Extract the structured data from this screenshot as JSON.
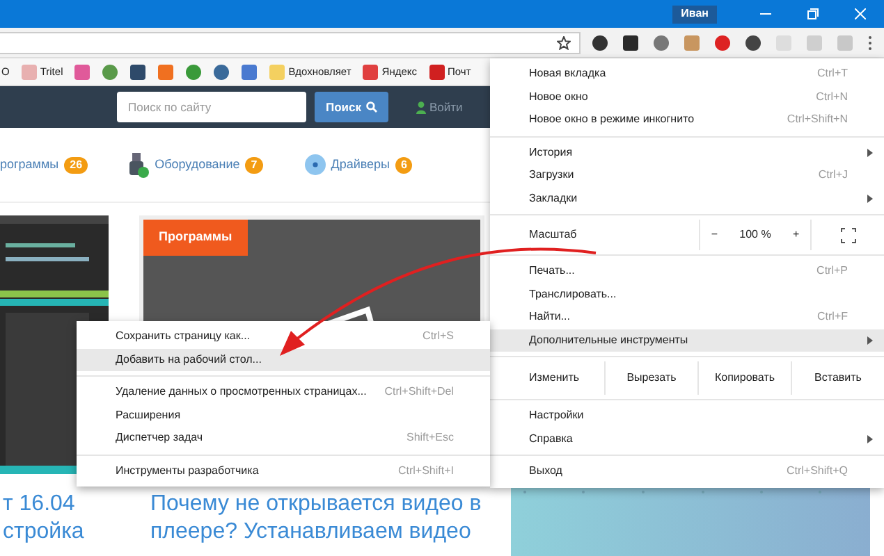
{
  "window": {
    "user": "Иван"
  },
  "bookmarks": [
    {
      "label": "О"
    },
    {
      "label": "Tritel"
    },
    {
      "label": "Вдохновляет"
    },
    {
      "label": "Яндекс"
    },
    {
      "label": "Почт"
    }
  ],
  "site": {
    "search": {
      "placeholder": "Поиск по сайту"
    },
    "search_button": "Поиск",
    "login": "Войти",
    "nav": [
      {
        "label": "рограммы",
        "count": "26"
      },
      {
        "label": "Оборудование",
        "count": "7"
      },
      {
        "label": "Драйверы",
        "count": "6"
      }
    ],
    "card_tag": "Программы",
    "articles": [
      {
        "lines": [
          "т 16.04",
          "стройка"
        ]
      },
      {
        "lines": [
          "Почему не открывается видео в",
          "плеере? Устанавливаем видео"
        ]
      }
    ]
  },
  "menu": [
    {
      "kind": "item",
      "label": "Новая вкладка",
      "shortcut": "Ctrl+T"
    },
    {
      "kind": "item",
      "label": "Новое окно",
      "shortcut": "Ctrl+N"
    },
    {
      "kind": "item",
      "label": "Новое окно в режиме инкогнито",
      "shortcut": "Ctrl+Shift+N"
    },
    {
      "kind": "divider"
    },
    {
      "kind": "item",
      "label": "История",
      "submenu": true
    },
    {
      "kind": "item",
      "label": "Загрузки",
      "shortcut": "Ctrl+J"
    },
    {
      "kind": "item",
      "label": "Закладки",
      "submenu": true
    },
    {
      "kind": "divider"
    },
    {
      "kind": "zoom",
      "label": "Масштаб",
      "minus": "−",
      "value": "100 %",
      "plus": "+"
    },
    {
      "kind": "divider"
    },
    {
      "kind": "item",
      "label": "Печать...",
      "shortcut": "Ctrl+P"
    },
    {
      "kind": "item",
      "label": "Транслировать..."
    },
    {
      "kind": "item",
      "label": "Найти...",
      "shortcut": "Ctrl+F"
    },
    {
      "kind": "item",
      "label": "Дополнительные инструменты",
      "submenu": true,
      "selected": true
    },
    {
      "kind": "divider"
    },
    {
      "kind": "edit",
      "label": "Изменить",
      "buttons": [
        "Вырезать",
        "Копировать",
        "Вставить"
      ]
    },
    {
      "kind": "divider"
    },
    {
      "kind": "item",
      "label": "Настройки"
    },
    {
      "kind": "item",
      "label": "Справка",
      "submenu": true
    },
    {
      "kind": "divider"
    },
    {
      "kind": "item",
      "label": "Выход",
      "shortcut": "Ctrl+Shift+Q"
    }
  ],
  "submenu": [
    {
      "kind": "item",
      "label": "Сохранить страницу как...",
      "shortcut": "Ctrl+S",
      "selected": false
    },
    {
      "kind": "item",
      "label": "Добавить на рабочий стол...",
      "selected": true
    },
    {
      "kind": "divider"
    },
    {
      "kind": "item",
      "label": "Удаление данных о просмотренных страницах...",
      "shortcut": "Ctrl+Shift+Del",
      "selected": false
    },
    {
      "kind": "item",
      "label": "Расширения",
      "selected": false
    },
    {
      "kind": "item",
      "label": "Диспетчер задач",
      "shortcut": "Shift+Esc",
      "selected": false
    },
    {
      "kind": "divider"
    },
    {
      "kind": "item",
      "label": "Инструменты разработчика",
      "shortcut": "Ctrl+Shift+I",
      "selected": false
    }
  ]
}
